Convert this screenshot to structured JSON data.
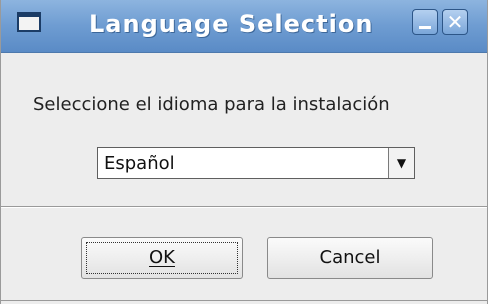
{
  "window": {
    "title": "Language Selection",
    "minimize_icon": "minimize-icon",
    "close_icon": "close-icon",
    "app_icon": "window-icon"
  },
  "dialog": {
    "prompt": "Seleccione el idioma para la instalación",
    "language_select": {
      "selected_value": "Español",
      "arrow_glyph": "▼"
    },
    "buttons": {
      "ok_label": "OK",
      "cancel_label": "Cancel"
    }
  },
  "colors": {
    "titlebar": "#6f9dd2",
    "window_background": "#ededed"
  }
}
